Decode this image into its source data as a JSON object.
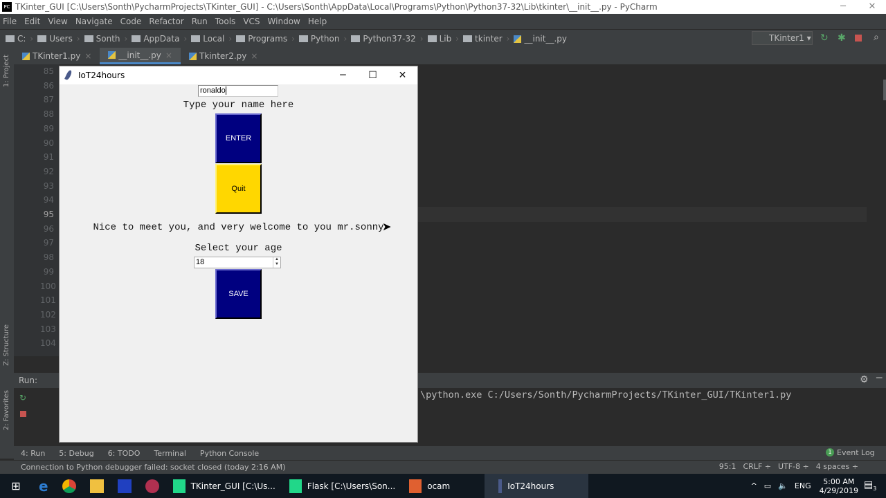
{
  "ide": {
    "title": "TKinter_GUI [C:\\Users\\Sonth\\PycharmProjects\\TKinter_GUI] - C:\\Users\\Sonth\\AppData\\Local\\Programs\\Python\\Python37-32\\Lib\\tkinter\\__init__.py - PyCharm",
    "logo": "PC",
    "menu": [
      "File",
      "Edit",
      "View",
      "Navigate",
      "Code",
      "Refactor",
      "Run",
      "Tools",
      "VCS",
      "Window",
      "Help"
    ],
    "breadcrumbs": [
      "C:",
      "Users",
      "Sonth",
      "AppData",
      "Local",
      "Programs",
      "Python",
      "Python37-32",
      "Lib",
      "tkinter",
      "__init__.py"
    ],
    "run_config": "TKinter1",
    "tabs": [
      {
        "label": "TKinter1.py"
      },
      {
        "label": "__init__.py",
        "active": true
      },
      {
        "label": "Tkinter2.py"
      }
    ],
    "side_labels": [
      "1: Project",
      "Z: Structure",
      "2: Favorites"
    ],
    "line_numbers": [
      "85",
      "86",
      "87",
      "88",
      "89",
      "90",
      "91",
      "92",
      "93",
      "94",
      "95",
      "96",
      "97",
      "98",
      "99",
      "100",
      "101",
      "102",
      "103",
      "104"
    ],
    "current_line": "95",
    "run_label": "Run:",
    "run_output": "\\python.exe C:/Users/Sonth/PycharmProjects/TKinter_GUI/TKinter1.py",
    "tool_buttons": [
      "4: Run",
      "5: Debug",
      "6: TODO",
      "Terminal",
      "Python Console"
    ],
    "event_log": "Event Log",
    "event_count": "1",
    "status_message": "Connection to Python debugger failed: socket closed (today 2:16 AM)",
    "status_right": [
      "95:1",
      "CRLF ÷",
      "UTF-8 ÷",
      "4 spaces ÷"
    ]
  },
  "taskbar": {
    "items": [
      "TKinter_GUI [C:\\Us...",
      "Flask [C:\\Users\\Son...",
      "ocam",
      "IoT24hours"
    ],
    "active": "IoT24hours",
    "lang": "ENG",
    "time": "5:00 AM",
    "date": "4/29/2019",
    "notifications": "3"
  },
  "tkwin": {
    "title": "IoT24hours",
    "name_value": "ronaldo",
    "name_label": "Type your name here",
    "enter_label": "ENTER",
    "quit_label": "Quit",
    "greeting": "Nice to meet you, and very welcome to you mr.sonny",
    "age_label": "Select your age",
    "age_value": "18",
    "save_label": "SAVE",
    "colors": {
      "enter": "#000080",
      "quit": "#ffd700",
      "save": "#000080"
    }
  }
}
